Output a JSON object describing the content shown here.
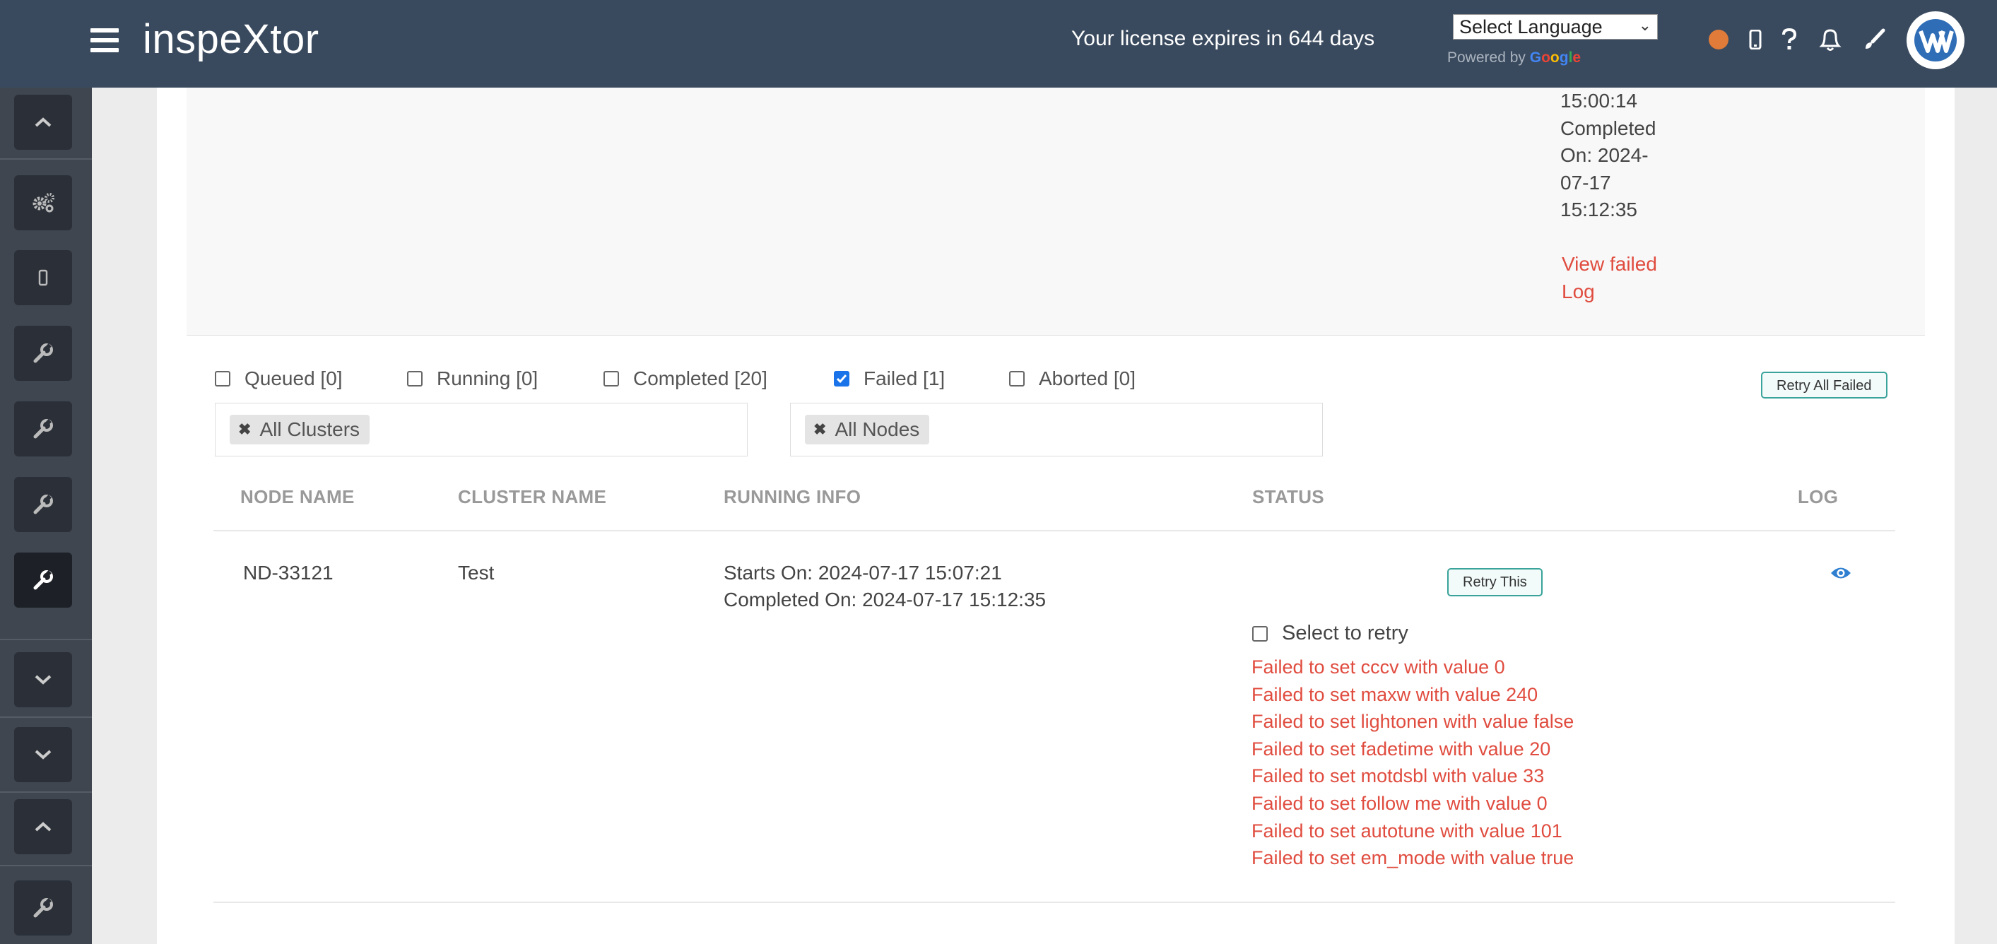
{
  "header": {
    "brand": "inspeXtor",
    "license_text": "Your license expires in 644 days",
    "language_select": "Select Language",
    "powered_by": "Powered by",
    "google_letters": [
      "G",
      "o",
      "o",
      "g",
      "l",
      "e"
    ],
    "icons": [
      "status-dot",
      "mobile-icon",
      "help-icon",
      "bell-icon",
      "brush-icon",
      "avatar"
    ]
  },
  "sidebar": {
    "buttons": [
      "chevron-up-icon",
      "gears-icon",
      "mobile-icon",
      "wrench-icon",
      "wrench-icon",
      "wrench-icon",
      "wrench-icon",
      "chevron-down-icon",
      "chevron-down-icon",
      "chevron-up-icon",
      "wrench-icon"
    ]
  },
  "previous_job": {
    "info": "15:00:14\nCompleted\nOn: 2024-\n07-17\n15:12:35",
    "view_failed_log": "View failed Log"
  },
  "filters": {
    "queued": {
      "label": "Queued [0]",
      "checked": false
    },
    "running": {
      "label": "Running [0]",
      "checked": false
    },
    "completed": {
      "label": "Completed [20]",
      "checked": false
    },
    "failed": {
      "label": "Failed [1]",
      "checked": true
    },
    "aborted": {
      "label": "Aborted [0]",
      "checked": false
    },
    "retry_all": "Retry All Failed",
    "cluster_tag": "All Clusters",
    "node_tag": "All Nodes"
  },
  "table": {
    "headers": {
      "node": "NODE NAME",
      "cluster": "CLUSTER NAME",
      "running": "RUNNING INFO",
      "status": "STATUS",
      "log": "LOG"
    },
    "rows": [
      {
        "node": "ND-33121",
        "cluster": "Test",
        "starts": "Starts On: 2024-07-17 15:07:21",
        "completed": "Completed On: 2024-07-17 15:12:35",
        "retry_button": "Retry This",
        "select_retry": "Select to retry",
        "errors": [
          "Failed to set cccv with value 0",
          "Failed to set maxw with value 240",
          "Failed to set lightonen with value false",
          "Failed to set fadetime with value 20",
          "Failed to set motdsbl with value 33",
          "Failed to set follow me with value 0",
          "Failed to set autotune with value 101",
          "Failed to set em_mode with value true"
        ]
      }
    ]
  },
  "colors": {
    "header_bg": "#3a4a5e",
    "sidebar_bg": "#3f4650",
    "error": "#e04c3f",
    "accent_teal": "#3aa39a",
    "status_dot": "#e07b39"
  }
}
